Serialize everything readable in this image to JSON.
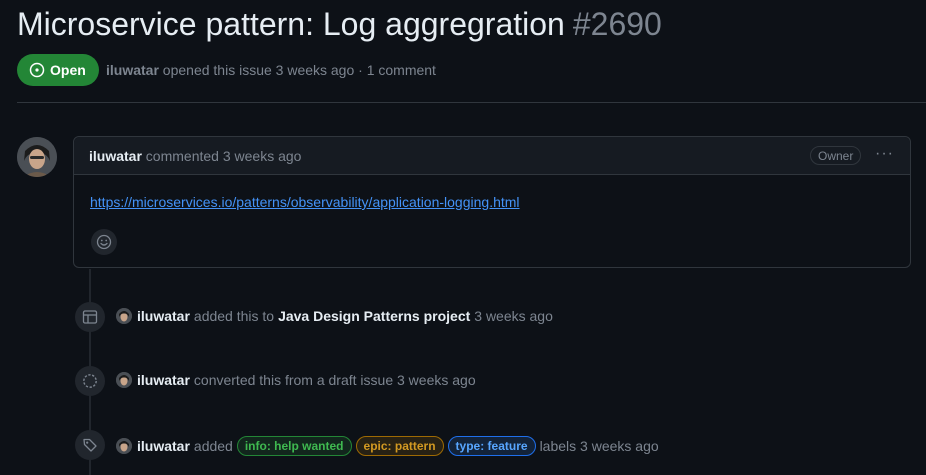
{
  "issue": {
    "title": "Microservice pattern: Log aggregration",
    "number": "#2690",
    "state": "Open",
    "author": "iluwatar",
    "meta_text": "opened this issue 3 weeks ago · 1 comment"
  },
  "comment": {
    "author": "iluwatar",
    "action": "commented 3 weeks ago",
    "badge": "Owner",
    "more": "···",
    "body_link": "https://microservices.io/patterns/observability/application-logging.html"
  },
  "events": [
    {
      "icon": "table-icon",
      "actor": "iluwatar",
      "text": "added this to",
      "target": "Java Design Patterns project",
      "time": "3 weeks ago"
    },
    {
      "icon": "draft-circle-icon",
      "actor": "iluwatar",
      "text": "converted this from a draft issue 3 weeks ago"
    },
    {
      "icon": "tag-icon",
      "actor": "iluwatar",
      "text": "added",
      "labels": [
        {
          "name": "info: help wanted",
          "color": "#3fb950"
        },
        {
          "name": "epic: pattern",
          "color": "#d29922"
        },
        {
          "name": "type: feature",
          "color": "#58a6ff"
        }
      ],
      "after": "labels 3 weeks ago"
    }
  ],
  "colors": {
    "background": "#0d1117",
    "open_green": "#238636",
    "link_blue": "#4493f8",
    "muted": "#7d8590",
    "border": "#30363d"
  }
}
